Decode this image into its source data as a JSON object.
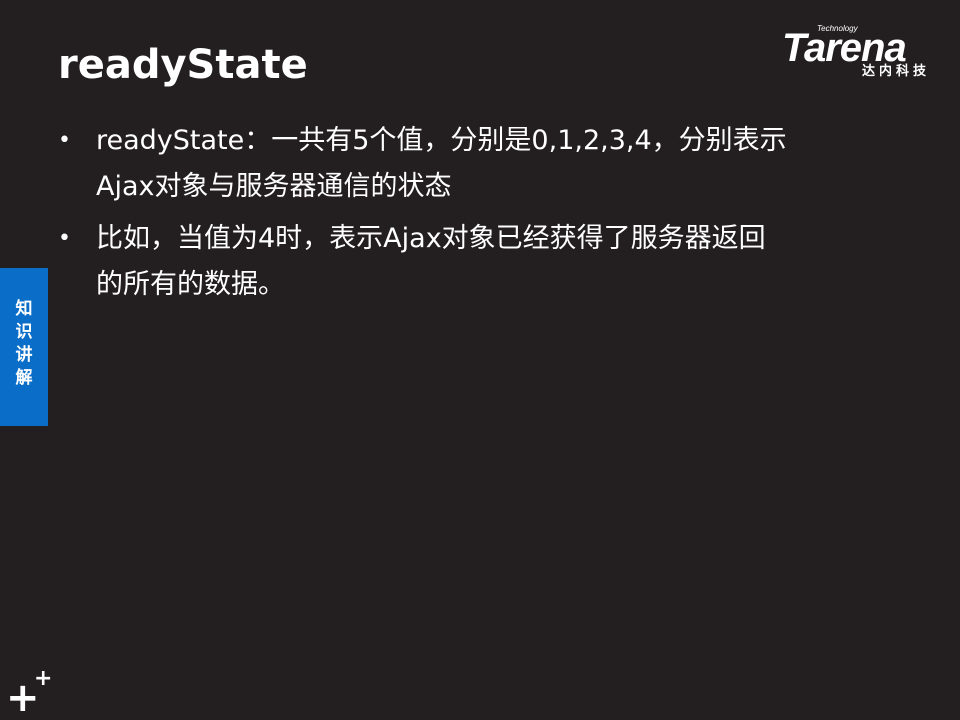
{
  "slide": {
    "title": "readyState",
    "brand": {
      "technology": "Technology",
      "name": "Tarena",
      "chinese": "达内科技"
    },
    "side_tab": {
      "chars": [
        "知",
        "识",
        "讲",
        "解"
      ]
    },
    "bullets": [
      {
        "lines": [
          "readyState：一共有5个值，分别是0,1,2,3,4，分别表示",
          "Ajax对象与服务器通信的状态"
        ]
      },
      {
        "lines": [
          "比如，当值为4时，表示Ajax对象已经获得了服务器返回",
          "的所有的数据。"
        ]
      }
    ],
    "footer": {
      "plus_big": "+",
      "plus_small": "+"
    }
  },
  "colors": {
    "background": "#231f20",
    "text": "#ffffff",
    "accent": "#0a6ec8"
  }
}
